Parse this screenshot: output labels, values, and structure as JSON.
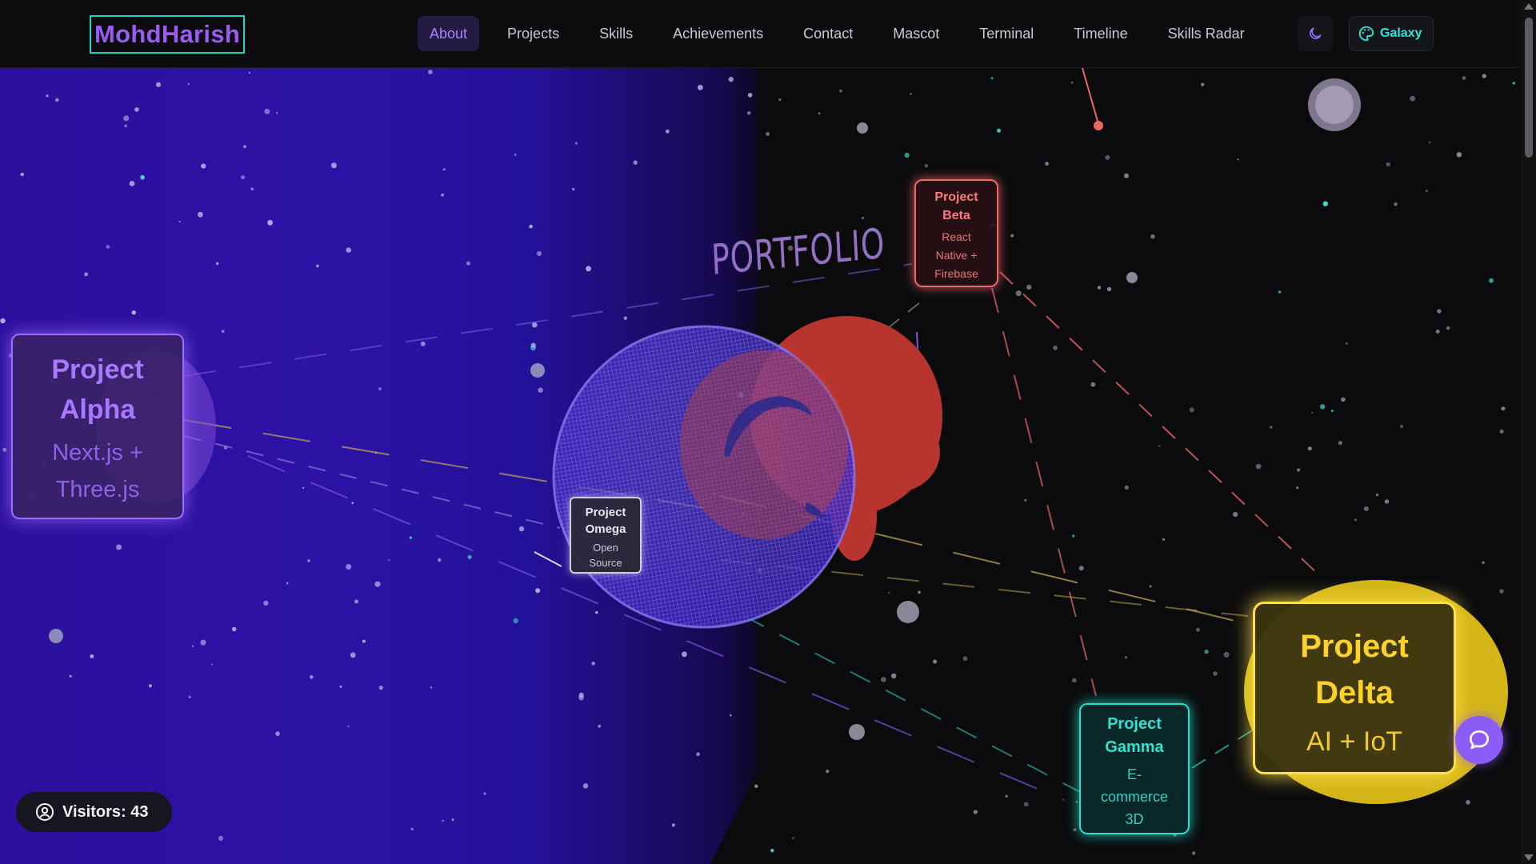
{
  "site": {
    "logo": "MohdHarish"
  },
  "nav": {
    "items": [
      {
        "label": "About",
        "active": true
      },
      {
        "label": "Projects",
        "active": false
      },
      {
        "label": "Skills",
        "active": false
      },
      {
        "label": "Achievements",
        "active": false
      },
      {
        "label": "Contact",
        "active": false
      },
      {
        "label": "Mascot",
        "active": false
      },
      {
        "label": "Terminal",
        "active": false
      },
      {
        "label": "Timeline",
        "active": false
      },
      {
        "label": "Skills Radar",
        "active": false
      }
    ],
    "theme_icon": "moon-icon",
    "theme_button": {
      "label": "Galaxy",
      "icon": "palette-icon"
    }
  },
  "scene": {
    "portfolio_label": "PORTFOLIO",
    "projects": {
      "alpha": {
        "title_line1": "Project",
        "title_line2": "Alpha",
        "sub_line1": "Next.js +",
        "sub_line2": "Three.js",
        "color": "#9d6bff"
      },
      "beta": {
        "title_line1": "Project",
        "title_line2": "Beta",
        "sub_line1": "React",
        "sub_line2": "Native +",
        "sub_line3": "Firebase",
        "color": "#f0666b"
      },
      "omega": {
        "title_line1": "Project",
        "title_line2": "Omega",
        "sub_line1": "Open",
        "sub_line2": "Source",
        "color": "#cfcfe0"
      },
      "gamma": {
        "title_line1": "Project",
        "title_line2": "Gamma",
        "sub_line1": "E-",
        "sub_line2": "commerce",
        "sub_line3": "3D",
        "color": "#28e0cf"
      },
      "delta": {
        "title_line1": "Project",
        "title_line2": "Delta",
        "sub_line1": "AI + IoT",
        "color": "#fde047"
      }
    }
  },
  "visitors": {
    "label": "Visitors: 43",
    "icon": "user-circle-icon"
  },
  "chat": {
    "icon": "chat-bubble-icon"
  },
  "colors": {
    "accent": "#9b5cf6",
    "teal": "#22d3c5",
    "background": "#0b0b0d",
    "panel_blue": "#2d12a6"
  }
}
